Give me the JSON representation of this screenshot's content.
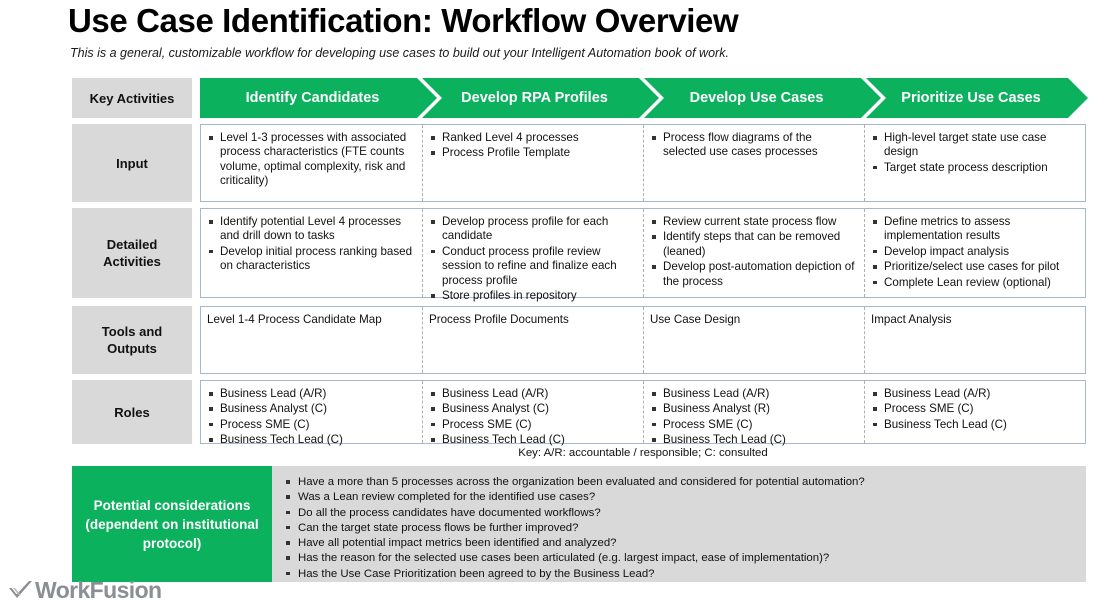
{
  "header": {
    "title": "Use Case Identification: Workflow Overview",
    "subtitle": "This is a general, customizable workflow for developing use cases to build out your Intelligent Automation book of work."
  },
  "colors": {
    "brand_green": "#0cb15e",
    "label_gray": "#d9d9d9",
    "panel_gray": "#d9d9d9",
    "table_border": "#a8b8cc",
    "logo_gray": "#8b8f94"
  },
  "row_labels": {
    "key_activities": "Key Activities",
    "input": "Input",
    "detailed_activities": "Detailed\nActivities",
    "tools_outputs": "Tools and\nOutputs",
    "roles": "Roles"
  },
  "phases": [
    "Identify Candidates",
    "Develop RPA Profiles",
    "Develop Use Cases",
    "Prioritize Use Cases"
  ],
  "input": [
    [
      "Level 1-3 processes with associated process characteristics (FTE counts volume, optimal complexity, risk and criticality)"
    ],
    [
      "Ranked Level 4 processes",
      "Process Profile Template"
    ],
    [
      "Process flow diagrams of the selected use cases processes"
    ],
    [
      "High-level target state use case design",
      "Target state process description"
    ]
  ],
  "detailed_activities": [
    [
      "Identify potential Level 4 processes and drill down to tasks",
      "Develop initial process  ranking based on characteristics"
    ],
    [
      "Develop process profile for each candidate",
      "Conduct process profile review session to refine and finalize each process profile",
      "Store profiles in repository"
    ],
    [
      "Review current state process flow",
      "Identify steps that can be removed (leaned)",
      "Develop post-automation depiction of the process"
    ],
    [
      "Define metrics to assess implementation results",
      "Develop impact analysis",
      "Prioritize/select use cases for pilot",
      "Complete Lean review (optional)"
    ]
  ],
  "tools_outputs": [
    "Level 1-4 Process Candidate Map",
    "Process Profile Documents",
    "Use Case Design",
    "Impact Analysis"
  ],
  "roles": [
    [
      "Business Lead (A/R)",
      "Business Analyst (C)",
      "Process SME (C)",
      "Business Tech Lead (C)"
    ],
    [
      "Business Lead (A/R)",
      "Business Analyst (C)",
      "Process SME (C)",
      "Business Tech Lead (C)"
    ],
    [
      "Business Lead (A/R)",
      "Business Analyst (R)",
      "Process SME (C)",
      "Business Tech Lead (C)"
    ],
    [
      "Business Lead (A/R)",
      "Process SME (C)",
      "Business Tech Lead (C)"
    ]
  ],
  "key_note": "Key: A/R: accountable / responsible; C: consulted",
  "considerations": {
    "label": "Potential considerations (dependent on institutional protocol)",
    "items": [
      "Have a more than 5 processes across the organization been evaluated and considered for potential automation?",
      "Was a Lean review completed for the identified use cases?",
      "Do all the process candidates have documented workflows?",
      "Can the target state process flows be further improved?",
      "Have all potential impact metrics been identified and analyzed?",
      "Has the reason for the selected use cases been articulated (e.g. largest impact, ease of implementation)?",
      "Has the Use Case Prioritization been agreed to by the Business Lead?"
    ]
  },
  "footer": {
    "logo_text": "WorkFusion"
  }
}
